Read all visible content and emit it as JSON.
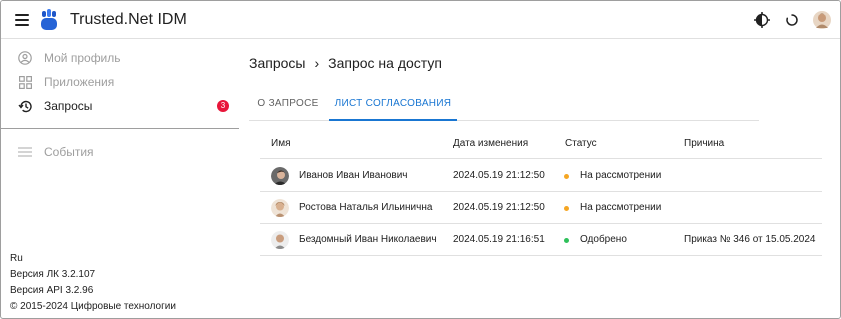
{
  "app": {
    "title": "Trusted.Net IDM"
  },
  "sidebar": {
    "items": [
      {
        "label": "Мой профиль",
        "icon": "user-circle-icon"
      },
      {
        "label": "Приложения",
        "icon": "apps-grid-icon"
      },
      {
        "label": "Запросы",
        "icon": "history-icon",
        "badge": "3",
        "active": true
      },
      {
        "label": "События",
        "icon": "events-list-icon"
      }
    ],
    "footer": {
      "language": "Ru",
      "lk_version": "Версия ЛК 3.2.107",
      "api_version": "Версия API 3.2.96",
      "copyright": "© 2015-2024 Цифровые технологии"
    }
  },
  "breadcrumb": {
    "parent": "Запросы",
    "separator": "›",
    "current": "Запрос на доступ"
  },
  "tabs": [
    {
      "label": "О ЗАПРОСЕ",
      "active": false
    },
    {
      "label": "ЛИСТ СОГЛАСОВАНИЯ",
      "active": true
    }
  ],
  "table": {
    "headers": {
      "name": "Имя",
      "date": "Дата изменения",
      "status": "Статус",
      "reason": "Причина"
    },
    "rows": [
      {
        "name": "Иванов Иван Иванович",
        "date": "2024.05.19 21:12:50",
        "status": "На рассмотрении",
        "status_color": "#f5a623",
        "reason": ""
      },
      {
        "name": "Ростова Наталья Ильинична",
        "date": "2024.05.19 21:12:50",
        "status": "На рассмотрении",
        "status_color": "#f5a623",
        "reason": ""
      },
      {
        "name": "Бездомный Иван Николаевич",
        "date": "2024.05.19 21:16:51",
        "status": "Одобрено",
        "status_color": "#2ec05a",
        "reason": "Приказ № 346 от 15.05.2024"
      }
    ]
  },
  "colors": {
    "accent": "#1976d2",
    "badge": "#e8163a"
  }
}
